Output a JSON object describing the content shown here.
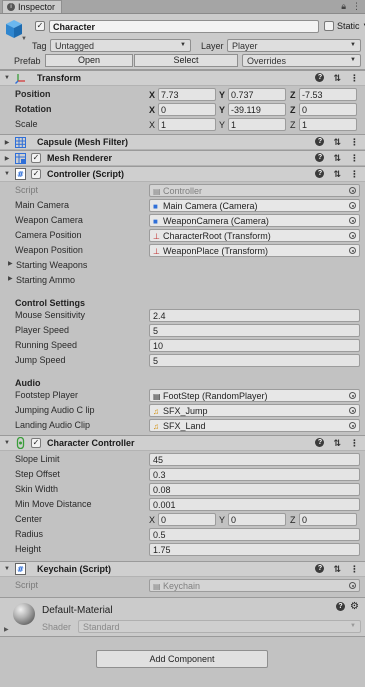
{
  "tab": {
    "label": "Inspector"
  },
  "header": {
    "name": "Character",
    "static_label": "Static",
    "tag_label": "Tag",
    "tag_value": "Untagged",
    "layer_label": "Layer",
    "layer_value": "Player",
    "prefab_label": "Prefab",
    "open_label": "Open",
    "select_label": "Select",
    "overrides_label": "Overrides"
  },
  "transform": {
    "title": "Transform",
    "position_label": "Position",
    "rotation_label": "Rotation",
    "scale_label": "Scale",
    "position": {
      "x": "7.73",
      "y": "0.737",
      "z": "-7.53"
    },
    "rotation": {
      "x": "0",
      "y": "-39.119",
      "z": "0"
    },
    "scale": {
      "x": "1",
      "y": "1",
      "z": "1"
    }
  },
  "mesh_filter": {
    "title": "Capsule (Mesh Filter)"
  },
  "mesh_renderer": {
    "title": "Mesh Renderer"
  },
  "controller": {
    "title": "Controller (Script)",
    "script_label": "Script",
    "script_value": "Controller",
    "main_camera_label": "Main Camera",
    "main_camera_value": "Main Camera (Camera)",
    "weapon_camera_label": "Weapon Camera",
    "weapon_camera_value": "WeaponCamera (Camera)",
    "camera_position_label": "Camera Position",
    "camera_position_value": "CharacterRoot (Transform)",
    "weapon_position_label": "Weapon Position",
    "weapon_position_value": "WeaponPlace (Transform)",
    "starting_weapons_label": "Starting Weapons",
    "starting_ammo_label": "Starting Ammo",
    "control_settings_header": "Control Settings",
    "mouse_sensitivity_label": "Mouse Sensitivity",
    "mouse_sensitivity_value": "2.4",
    "player_speed_label": "Player Speed",
    "player_speed_value": "5",
    "running_speed_label": "Running Speed",
    "running_speed_value": "10",
    "jump_speed_label": "Jump Speed",
    "jump_speed_value": "5",
    "audio_header": "Audio",
    "footstep_player_label": "Footstep Player",
    "footstep_player_value": "FootStep (RandomPlayer)",
    "jumping_audio_label": "Jumping Audio C lip",
    "jumping_audio_value": "SFX_Jump",
    "landing_audio_label": "Landing Audio Clip",
    "landing_audio_value": "SFX_Land"
  },
  "character_controller": {
    "title": "Character Controller",
    "slope_limit_label": "Slope Limit",
    "slope_limit_value": "45",
    "step_offset_label": "Step Offset",
    "step_offset_value": "0.3",
    "skin_width_label": "Skin Width",
    "skin_width_value": "0.08",
    "min_move_label": "Min Move Distance",
    "min_move_value": "0.001",
    "center_label": "Center",
    "center": {
      "x": "0",
      "y": "0",
      "z": "0"
    },
    "radius_label": "Radius",
    "radius_value": "0.5",
    "height_label": "Height",
    "height_value": "1.75"
  },
  "keychain": {
    "title": "Keychain (Script)",
    "script_label": "Script",
    "script_value": "Keychain"
  },
  "material": {
    "name": "Default-Material",
    "shader_label": "Shader",
    "shader_value": "Standard"
  },
  "add_component_label": "Add Component"
}
